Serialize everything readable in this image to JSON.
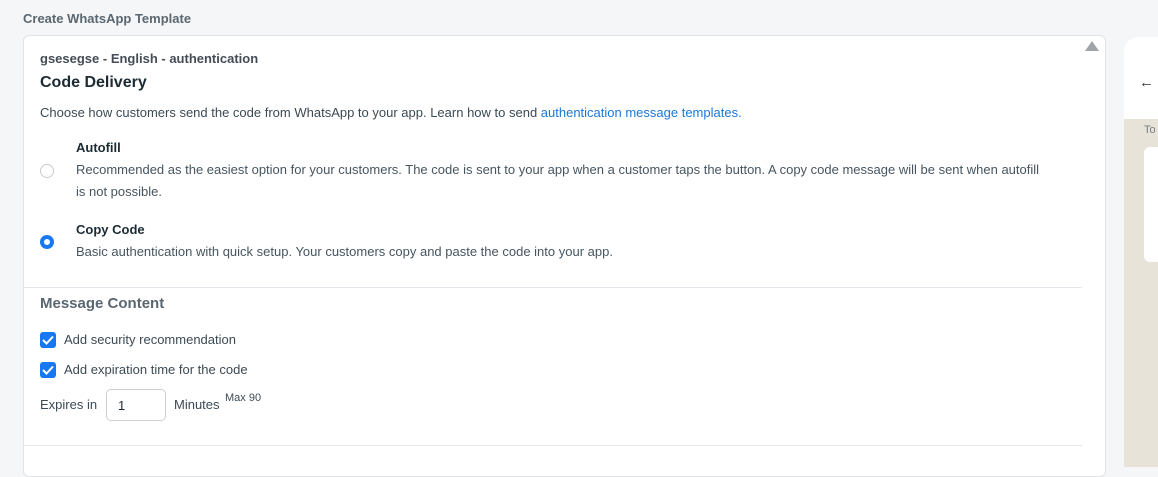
{
  "page": {
    "title": "Create WhatsApp Template"
  },
  "template": {
    "subtitle": "gsesegse - English - authentication",
    "section_title": "Code Delivery",
    "description": "Choose how customers send the code from WhatsApp to your app. Learn how to send ",
    "description_link": "authentication message templates."
  },
  "delivery_options": [
    {
      "title": "Autofill",
      "description": "Recommended as the easiest option for your customers. The code is sent to your app when a customer taps the button. A copy code message will be sent when autofill is not possible.",
      "selected": false
    },
    {
      "title": "Copy Code",
      "description": "Basic authentication with quick setup. Your customers copy and paste the code into your app.",
      "selected": true
    }
  ],
  "message_content": {
    "title": "Message Content",
    "security_label": "Add security recommendation",
    "security_checked": true,
    "expiration_label": "Add expiration time for the code",
    "expiration_checked": true,
    "expires_label": "Expires in",
    "expires_value": "1",
    "minutes_label": "Minutes",
    "max_label": "Max 90"
  },
  "preview": {
    "back_icon": "back-arrow-icon",
    "chat_label": "To"
  },
  "colors": {
    "accent": "#1877f2",
    "link": "#1a78d9"
  }
}
